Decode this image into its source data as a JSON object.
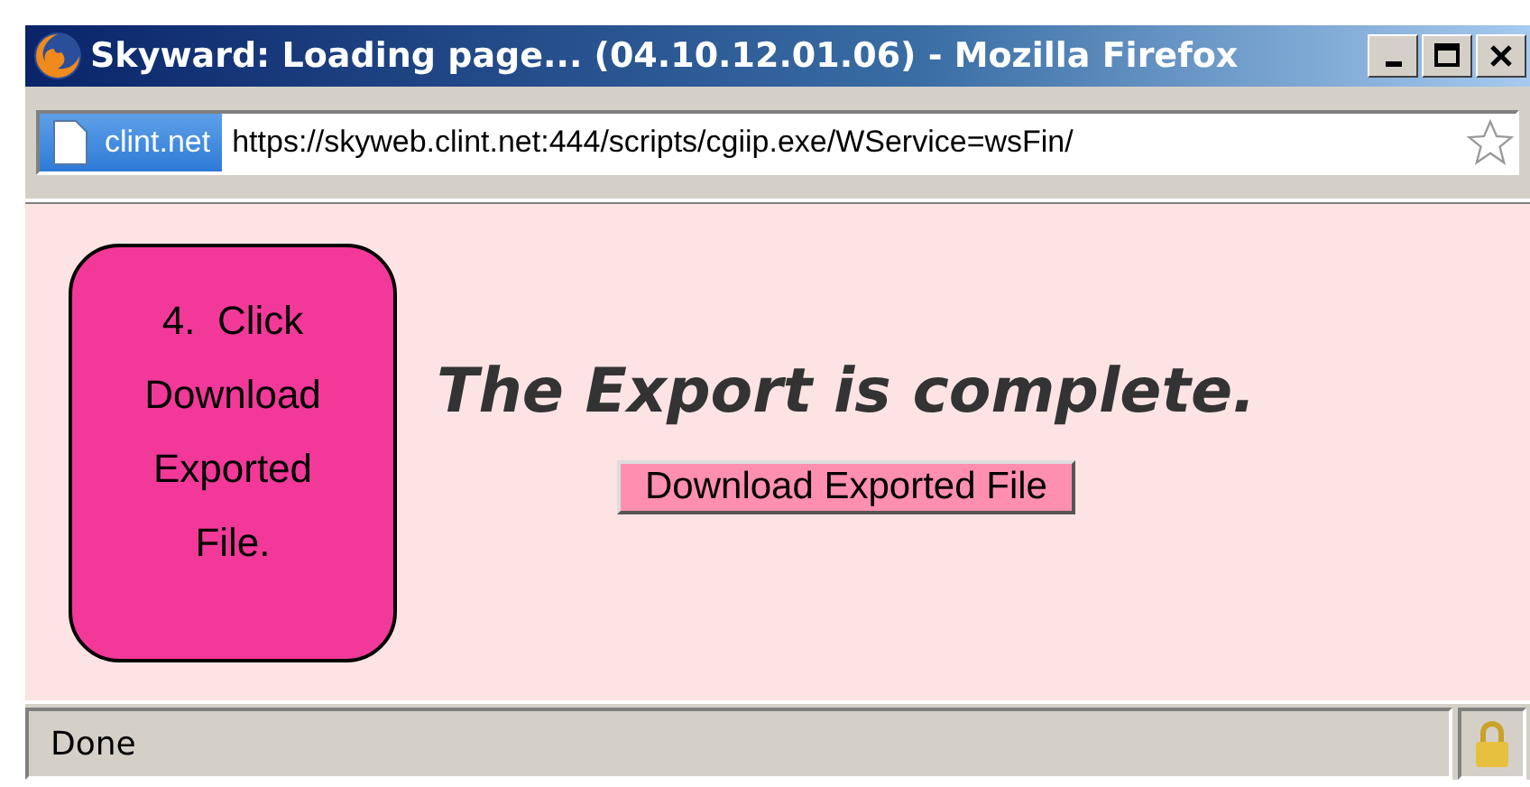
{
  "window": {
    "title": "Skyward: Loading page... (04.10.12.01.06) - Mozilla Firefox"
  },
  "address_bar": {
    "site_identity": "clint.net",
    "url": "https://skyweb.clint.net:444/scripts/cgiip.exe/WService=wsFin/"
  },
  "callout": {
    "text": "4.  Click Download Exported File."
  },
  "content": {
    "heading": "The Export is complete.",
    "button": "Download Exported File"
  },
  "status_bar": {
    "text": "Done",
    "secure": true
  }
}
